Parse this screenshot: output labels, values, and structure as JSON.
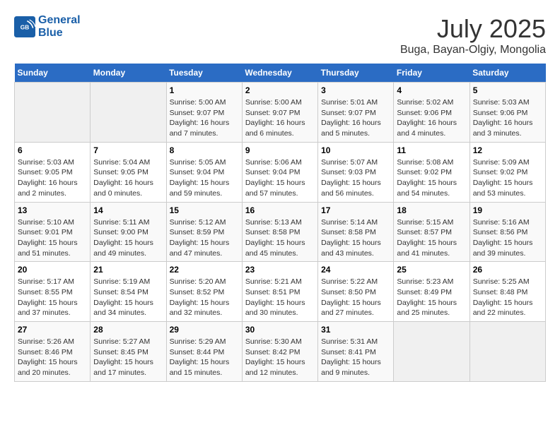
{
  "header": {
    "logo_line1": "General",
    "logo_line2": "Blue",
    "title": "July 2025",
    "subtitle": "Buga, Bayan-Olgiy, Mongolia"
  },
  "days_of_week": [
    "Sunday",
    "Monday",
    "Tuesday",
    "Wednesday",
    "Thursday",
    "Friday",
    "Saturday"
  ],
  "weeks": [
    [
      {
        "day": "",
        "empty": true
      },
      {
        "day": "",
        "empty": true
      },
      {
        "day": "1",
        "sunrise": "5:00 AM",
        "sunset": "9:07 PM",
        "daylight": "16 hours and 7 minutes."
      },
      {
        "day": "2",
        "sunrise": "5:00 AM",
        "sunset": "9:07 PM",
        "daylight": "16 hours and 6 minutes."
      },
      {
        "day": "3",
        "sunrise": "5:01 AM",
        "sunset": "9:07 PM",
        "daylight": "16 hours and 5 minutes."
      },
      {
        "day": "4",
        "sunrise": "5:02 AM",
        "sunset": "9:06 PM",
        "daylight": "16 hours and 4 minutes."
      },
      {
        "day": "5",
        "sunrise": "5:03 AM",
        "sunset": "9:06 PM",
        "daylight": "16 hours and 3 minutes."
      }
    ],
    [
      {
        "day": "6",
        "sunrise": "5:03 AM",
        "sunset": "9:05 PM",
        "daylight": "16 hours and 2 minutes."
      },
      {
        "day": "7",
        "sunrise": "5:04 AM",
        "sunset": "9:05 PM",
        "daylight": "16 hours and 0 minutes."
      },
      {
        "day": "8",
        "sunrise": "5:05 AM",
        "sunset": "9:04 PM",
        "daylight": "15 hours and 59 minutes."
      },
      {
        "day": "9",
        "sunrise": "5:06 AM",
        "sunset": "9:04 PM",
        "daylight": "15 hours and 57 minutes."
      },
      {
        "day": "10",
        "sunrise": "5:07 AM",
        "sunset": "9:03 PM",
        "daylight": "15 hours and 56 minutes."
      },
      {
        "day": "11",
        "sunrise": "5:08 AM",
        "sunset": "9:02 PM",
        "daylight": "15 hours and 54 minutes."
      },
      {
        "day": "12",
        "sunrise": "5:09 AM",
        "sunset": "9:02 PM",
        "daylight": "15 hours and 53 minutes."
      }
    ],
    [
      {
        "day": "13",
        "sunrise": "5:10 AM",
        "sunset": "9:01 PM",
        "daylight": "15 hours and 51 minutes."
      },
      {
        "day": "14",
        "sunrise": "5:11 AM",
        "sunset": "9:00 PM",
        "daylight": "15 hours and 49 minutes."
      },
      {
        "day": "15",
        "sunrise": "5:12 AM",
        "sunset": "8:59 PM",
        "daylight": "15 hours and 47 minutes."
      },
      {
        "day": "16",
        "sunrise": "5:13 AM",
        "sunset": "8:58 PM",
        "daylight": "15 hours and 45 minutes."
      },
      {
        "day": "17",
        "sunrise": "5:14 AM",
        "sunset": "8:58 PM",
        "daylight": "15 hours and 43 minutes."
      },
      {
        "day": "18",
        "sunrise": "5:15 AM",
        "sunset": "8:57 PM",
        "daylight": "15 hours and 41 minutes."
      },
      {
        "day": "19",
        "sunrise": "5:16 AM",
        "sunset": "8:56 PM",
        "daylight": "15 hours and 39 minutes."
      }
    ],
    [
      {
        "day": "20",
        "sunrise": "5:17 AM",
        "sunset": "8:55 PM",
        "daylight": "15 hours and 37 minutes."
      },
      {
        "day": "21",
        "sunrise": "5:19 AM",
        "sunset": "8:54 PM",
        "daylight": "15 hours and 34 minutes."
      },
      {
        "day": "22",
        "sunrise": "5:20 AM",
        "sunset": "8:52 PM",
        "daylight": "15 hours and 32 minutes."
      },
      {
        "day": "23",
        "sunrise": "5:21 AM",
        "sunset": "8:51 PM",
        "daylight": "15 hours and 30 minutes."
      },
      {
        "day": "24",
        "sunrise": "5:22 AM",
        "sunset": "8:50 PM",
        "daylight": "15 hours and 27 minutes."
      },
      {
        "day": "25",
        "sunrise": "5:23 AM",
        "sunset": "8:49 PM",
        "daylight": "15 hours and 25 minutes."
      },
      {
        "day": "26",
        "sunrise": "5:25 AM",
        "sunset": "8:48 PM",
        "daylight": "15 hours and 22 minutes."
      }
    ],
    [
      {
        "day": "27",
        "sunrise": "5:26 AM",
        "sunset": "8:46 PM",
        "daylight": "15 hours and 20 minutes."
      },
      {
        "day": "28",
        "sunrise": "5:27 AM",
        "sunset": "8:45 PM",
        "daylight": "15 hours and 17 minutes."
      },
      {
        "day": "29",
        "sunrise": "5:29 AM",
        "sunset": "8:44 PM",
        "daylight": "15 hours and 15 minutes."
      },
      {
        "day": "30",
        "sunrise": "5:30 AM",
        "sunset": "8:42 PM",
        "daylight": "15 hours and 12 minutes."
      },
      {
        "day": "31",
        "sunrise": "5:31 AM",
        "sunset": "8:41 PM",
        "daylight": "15 hours and 9 minutes."
      },
      {
        "day": "",
        "empty": true
      },
      {
        "day": "",
        "empty": true
      }
    ]
  ]
}
